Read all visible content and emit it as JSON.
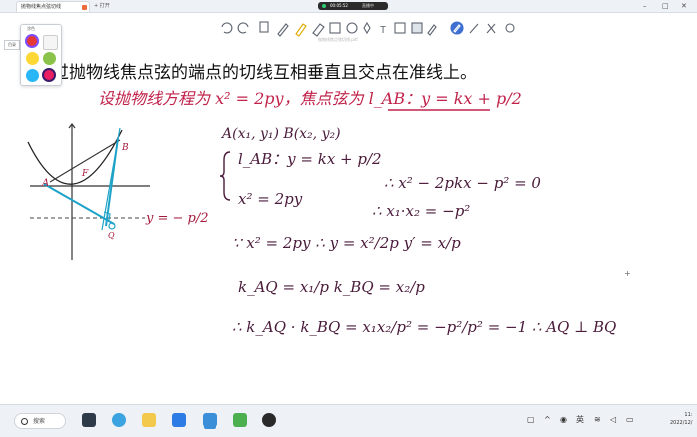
{
  "window": {
    "tab_title": "抛物线焦点弦切线",
    "open_label": "+ 打开",
    "recording_time": "00:05:52",
    "recording_label": "直播中"
  },
  "toolbar": {
    "subtitle": "抛物线焦点弦切线.pdf",
    "tools": [
      "undo-icon",
      "redo-icon",
      "copy-icon",
      "pen-icon",
      "highlighter-icon",
      "eraser-icon",
      "rectangle-icon",
      "circle-icon",
      "star-icon",
      "text-icon",
      "image-icon",
      "fill-icon",
      "pen-active-icon",
      "lasso-icon",
      "ruler-icon",
      "settings-icon"
    ]
  },
  "sidebar": {
    "catalog_label": "目录"
  },
  "palette": {
    "label": "涂色",
    "colors": [
      "#e53935",
      "#f5f5f5",
      "#fdd835",
      "#8bc34a",
      "#29b6f6",
      "#e91e63"
    ]
  },
  "content": {
    "headline": "过抛物线焦点弦的端点的切线互相垂直且交点在准线上。",
    "lines": [
      "设抛物线方程为 x² = 2py，焦点弦为 l_AB：y = kx + p/2",
      "A(x₁, y₁)    B(x₂, y₂)",
      "l_AB：y = kx + p/2",
      "x² = 2py",
      "∴ x² − 2pkx − p² = 0",
      "∴ x₁·x₂ = −p²",
      "∵ x² = 2py    ∴ y = x²/2p    y′ = x/p",
      "k_AQ = x₁/p      k_BQ = x₂/p",
      "∴ k_AQ · k_BQ = x₁x₂/p² = −p²/p² = −1    ∴ AQ ⊥ BQ"
    ],
    "figure": {
      "point_A": "A",
      "point_B": "B",
      "point_F": "F",
      "point_Q": "Q",
      "directrix_label": "y = − p/2"
    }
  },
  "taskbar": {
    "search_label": "搜索",
    "ime": "英",
    "time": "11:",
    "date": "2022/12/"
  }
}
